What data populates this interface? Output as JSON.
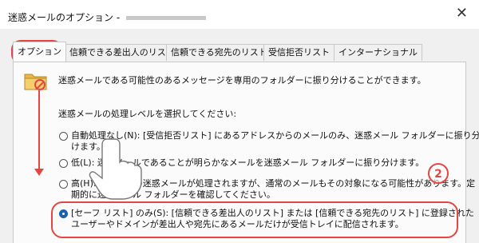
{
  "window": {
    "title": "迷惑メールのオプション -",
    "close_glyph": "✕"
  },
  "tabs": [
    {
      "label": "オプション",
      "active": true
    },
    {
      "label": "信頼できる差出人のリスト",
      "active": false
    },
    {
      "label": "信頼できる宛先のリスト",
      "active": false
    },
    {
      "label": "受信拒否リスト",
      "active": false
    },
    {
      "label": "インターナショナル",
      "active": false
    }
  ],
  "panel": {
    "description": "迷惑メールである可能性のあるメッセージを専用のフォルダーに振り分けることができます。",
    "level_label": "迷惑メールの処理レベルを選択してください:",
    "options": [
      {
        "line1": "自動処理なし(N): [受信拒否リスト] にあるアドレスからのメールのみ、迷惑メール フォルダーに振り分",
        "line2": "けます。",
        "checked": false
      },
      {
        "line1": "低(L): 迷惑メールであることが明らかなメールを迷惑メール フォルダーに振り分けます。",
        "line2": "",
        "checked": false
      },
      {
        "line1": "高(H): ほとんどの迷惑メールが処理されますが、通常のメールもその対象になる可能性があります。定",
        "line2": "期的に迷惑メール フォルダーを確認してください。",
        "checked": false
      },
      {
        "line1": "[セーフ リスト] のみ(S): [信頼できる差出人のリスト] または [信頼できる宛先のリスト] に登録された",
        "line2": "ユーザーやドメインが差出人や宛先にあるメールだけが受信トレイに配信されます。",
        "checked": true
      }
    ]
  },
  "annotation": {
    "step_number": "2",
    "color": "#e64545"
  }
}
